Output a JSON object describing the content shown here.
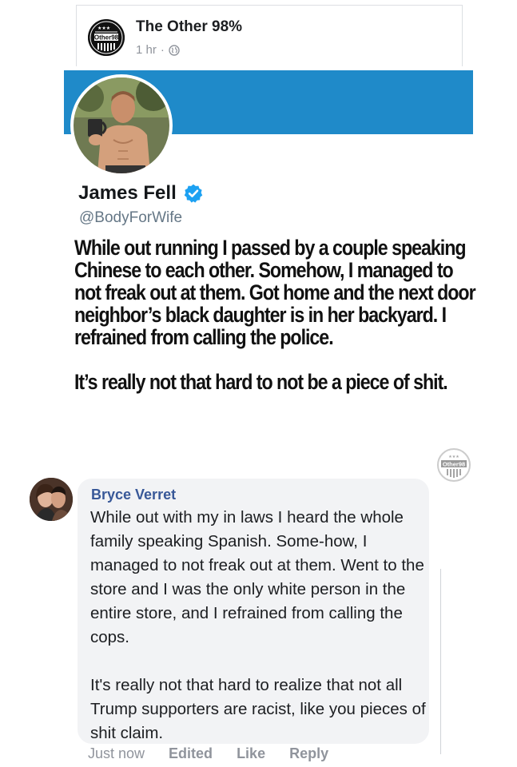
{
  "page_post": {
    "page_name": "The Other 98%",
    "time": "1 hr",
    "separator": "·",
    "avatar_text": "Other98",
    "privacy_icon": "globe-icon"
  },
  "tweet": {
    "display_name": "James Fell",
    "verified_icon": "verified-badge-icon",
    "handle": "@BodyForWife",
    "paragraphs": [
      "While out running I passed by a couple speaking Chinese to each other. Somehow, I managed to not freak out at them. Got home and the next door neighbor’s black daughter is in her backyard. I refrained from calling the police.",
      "It’s really not that hard to not be a piece of shit."
    ],
    "banner_color": "#1f8ac9"
  },
  "watermark": {
    "text": "Other98"
  },
  "comment": {
    "author": "Bryce Verret",
    "paragraphs": [
      "While out with my in laws I heard the whole family speaking Spanish. Some-how, I managed to not freak out at them. Went to the store and I was the only white person in the entire store, and I refrained from calling the cops.",
      "It's really not that hard to realize that not all Trump supporters are racist,  like you pieces of shit claim."
    ],
    "actions": {
      "timestamp": "Just now",
      "edited": "Edited",
      "like": "Like",
      "reply": "Reply"
    },
    "name_color": "#385898"
  }
}
